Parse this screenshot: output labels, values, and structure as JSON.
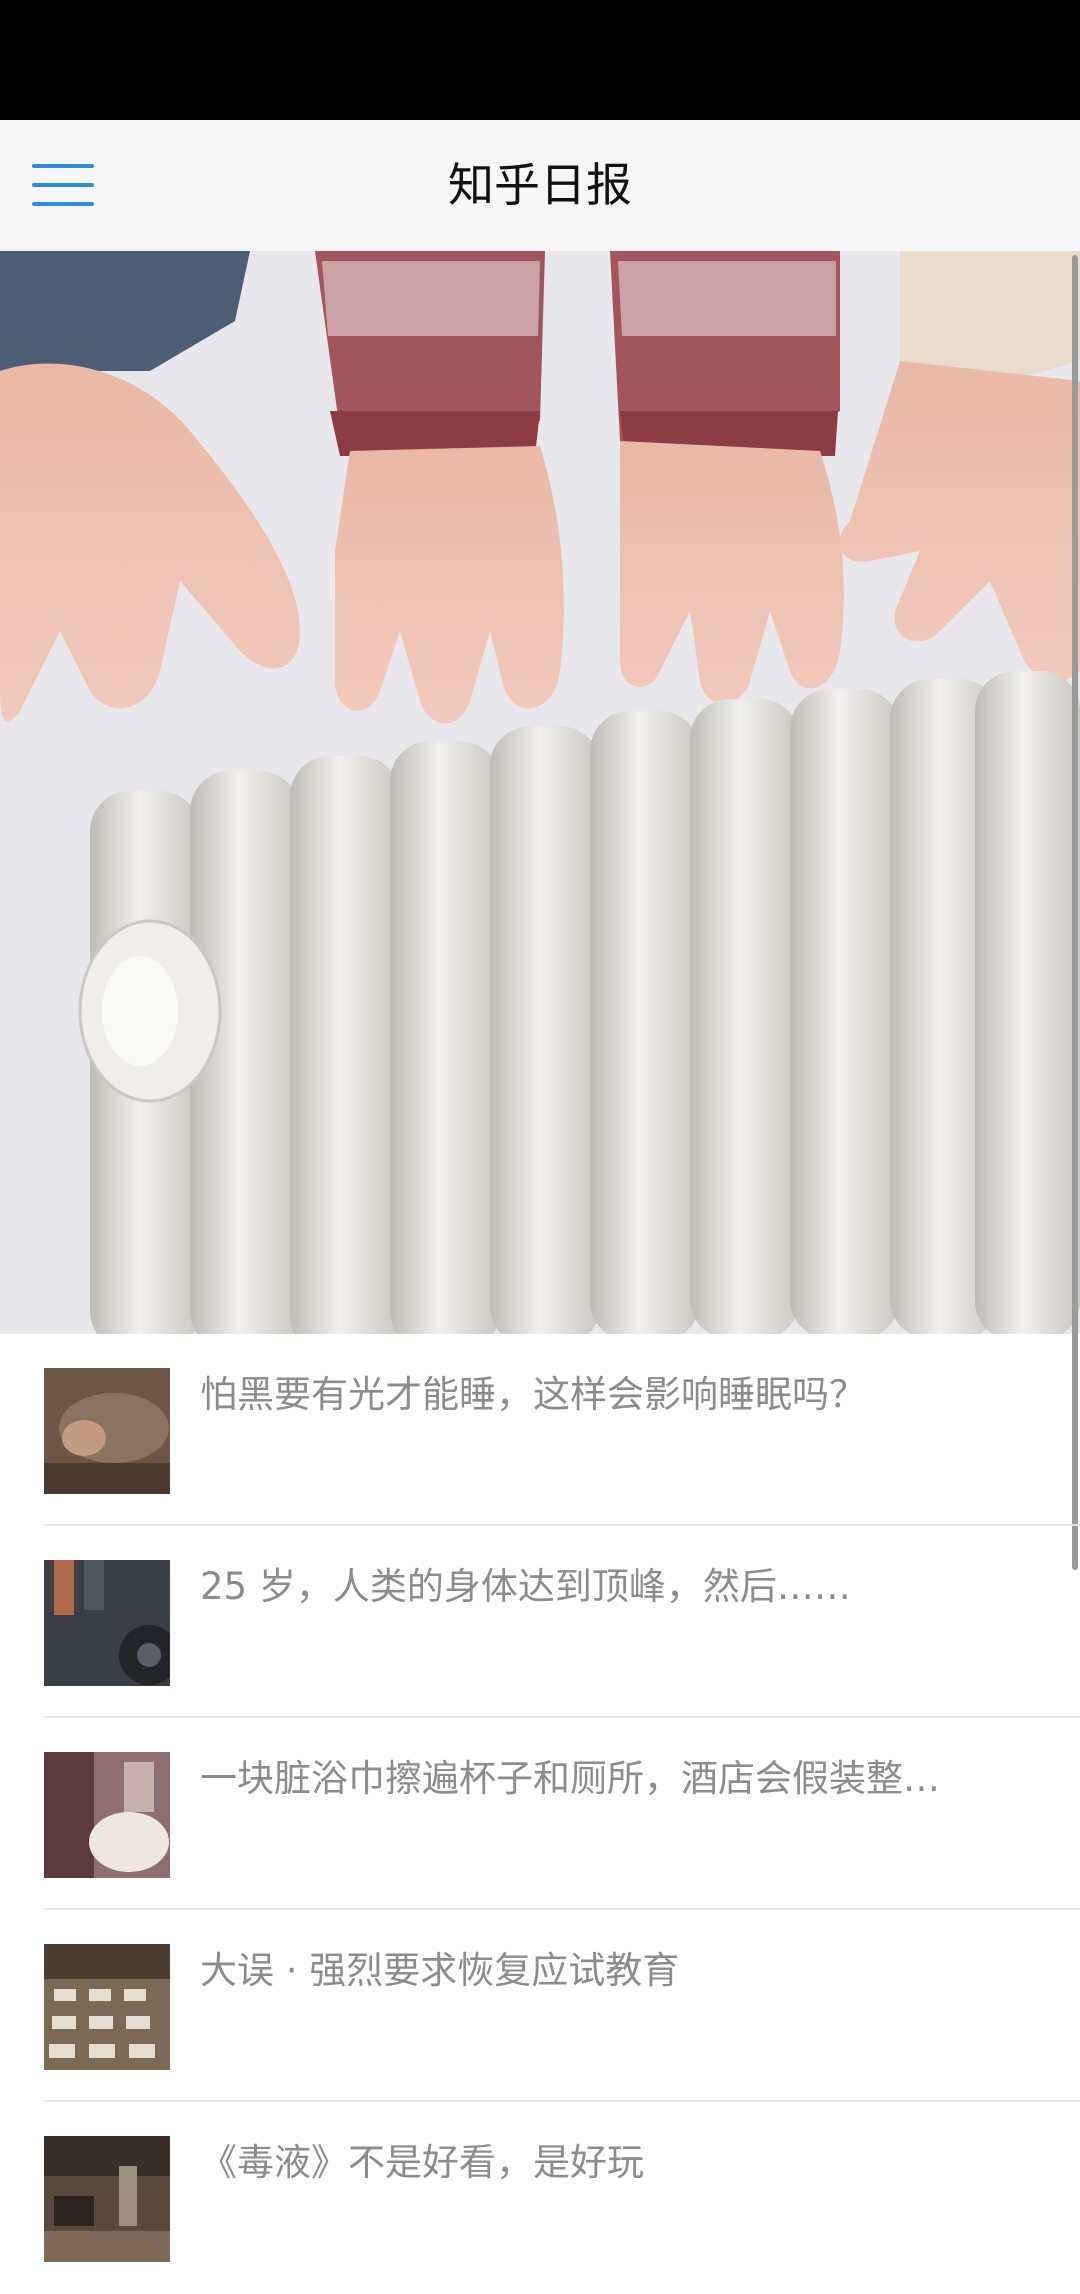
{
  "header": {
    "title": "知乎日报",
    "menu_icon": "hamburger-menu-icon",
    "accent": "#2a8de0"
  },
  "banner": {
    "slide_count": 5,
    "active_index": 2
  },
  "news": [
    {
      "title": "怕黑要有光才能睡，这样会影响睡眠吗？"
    },
    {
      "title": "25 岁，人类的身体达到顶峰，然后……"
    },
    {
      "title": "一块脏浴巾擦遍杯子和厕所，酒店会假装整…"
    },
    {
      "title": "大误 · 强烈要求恢复应试教育"
    },
    {
      "title": "《毒液》不是好看，是好玩"
    }
  ]
}
